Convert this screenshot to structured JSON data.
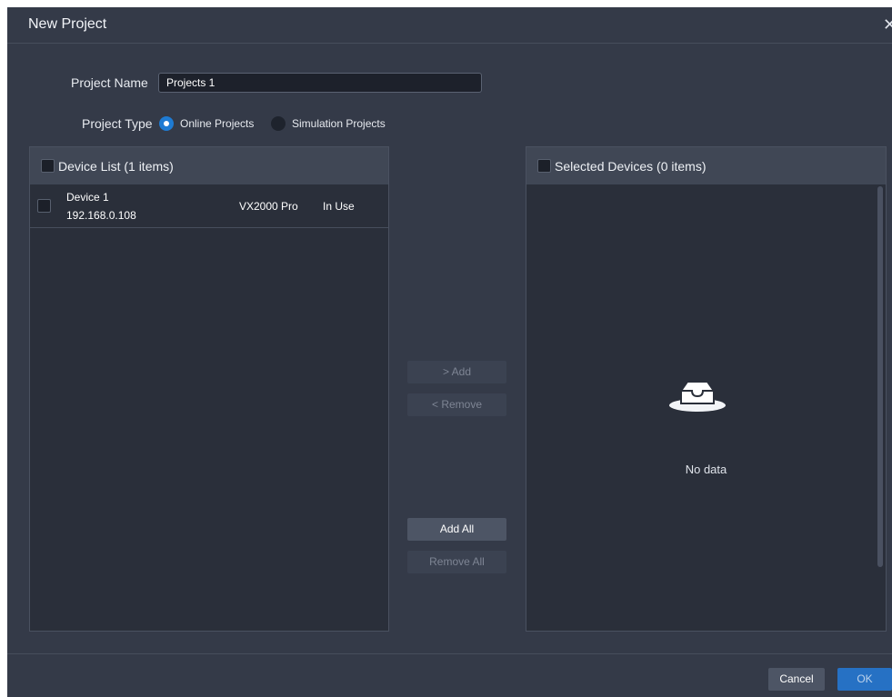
{
  "dialog": {
    "title": "New Project"
  },
  "form": {
    "project_name_label": "Project Name",
    "project_name_value": "Projects 1",
    "project_type_label": "Project Type",
    "project_type_options": [
      {
        "label": "Online Projects",
        "checked": true
      },
      {
        "label": "Simulation Projects",
        "checked": false
      }
    ]
  },
  "device_list": {
    "header": "Device List  (1 items)",
    "devices": [
      {
        "name": "Device 1",
        "ip": "192.168.0.108",
        "model": "VX2000 Pro",
        "status": "In Use"
      }
    ]
  },
  "selected_devices": {
    "header": "Selected Devices  (0 items)",
    "empty_text": "No data"
  },
  "transfer_buttons": {
    "add": "> Add",
    "remove": "< Remove",
    "add_all": "Add All",
    "remove_all": "Remove All"
  },
  "footer": {
    "cancel": "Cancel",
    "ok": "OK"
  },
  "colors": {
    "background": "#343a48",
    "panel": "#2a2f3a",
    "accent": "#1e7bd3",
    "ok_button": "#2671c4"
  }
}
